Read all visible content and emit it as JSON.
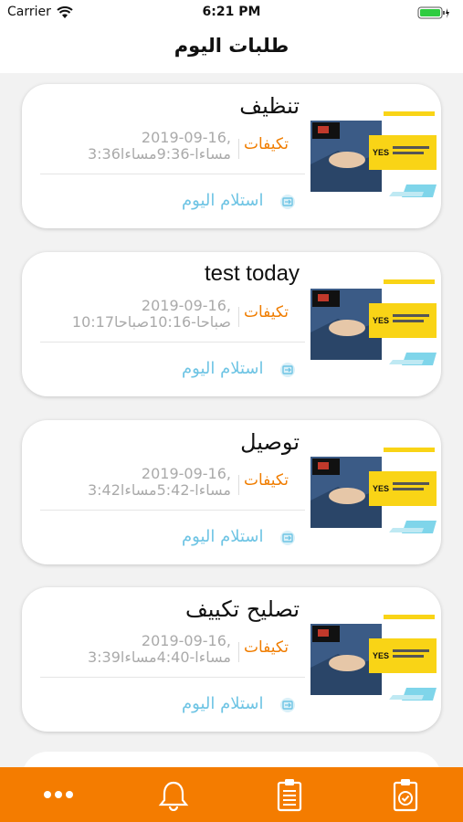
{
  "status": {
    "carrier": "Carrier",
    "time": "6:21 PM"
  },
  "nav": {
    "title": "طلبات اليوم"
  },
  "orders": [
    {
      "title": "تنظيف",
      "category": "تكيفات",
      "date_line1": "2019-09-16,",
      "date_line2": "3:36مساءا-9:36مساءا",
      "action": "استلام اليوم"
    },
    {
      "title": "test today",
      "category": "تكيفات",
      "date_line1": "2019-09-16,",
      "date_line2": "10:17صباحا-10:16صباحا",
      "action": "استلام اليوم"
    },
    {
      "title": "توصيل",
      "category": "تكيفات",
      "date_line1": "2019-09-16,",
      "date_line2": "3:42مساءا-5:42مساءا",
      "action": "استلام اليوم"
    },
    {
      "title": "تصليح تكييف",
      "category": "تكيفات",
      "date_line1": "2019-09-16,",
      "date_line2": "3:39مساءا-4:40مساءا",
      "action": "استلام اليوم"
    }
  ],
  "tabs": [
    {
      "icon": "more-dots-icon"
    },
    {
      "icon": "bell-icon"
    },
    {
      "icon": "clipboard-list-icon"
    },
    {
      "icon": "clipboard-check-icon"
    }
  ],
  "colors": {
    "accent": "#f47c00",
    "category": "#f07d00",
    "link": "#6ec4e4"
  }
}
